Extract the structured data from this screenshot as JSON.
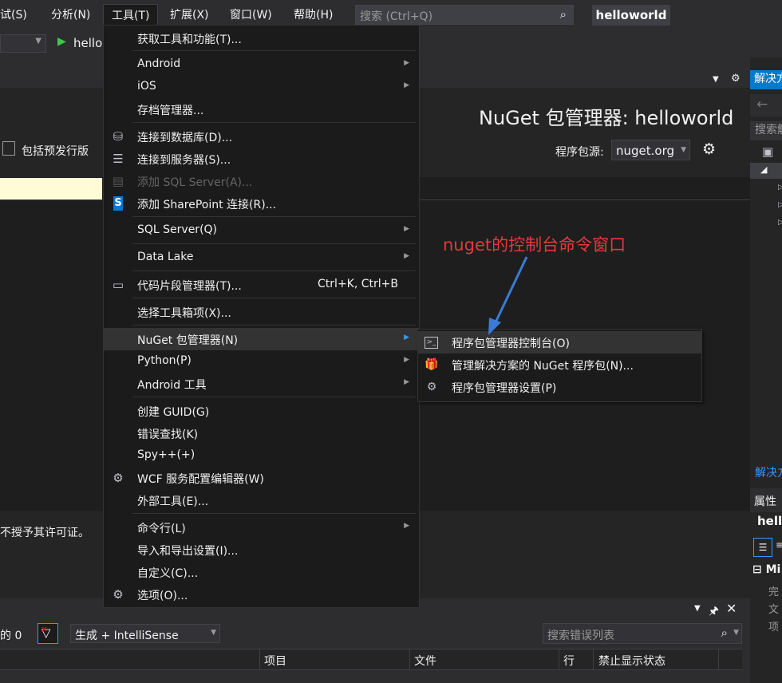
{
  "menubar": {
    "items": [
      "试(S)",
      "分析(N)",
      "工具(T)",
      "扩展(X)",
      "窗口(W)",
      "帮助(H)"
    ],
    "search_placeholder": "搜索 (Ctrl+Q)",
    "solution_title": "helloworld"
  },
  "toolbar": {
    "run_label": "hello"
  },
  "nuget_page": {
    "title": "NuGet 包管理器: helloworld",
    "include_prerelease": "包括预发行版",
    "source_label": "程序包源:",
    "source_value": "nuget.org",
    "license_text": "不授予其许可证。"
  },
  "tools_menu": {
    "items": [
      {
        "label": "获取工具和功能(T)..."
      },
      {
        "label": "Android"
      },
      {
        "label": "iOS"
      },
      {
        "label": "存档管理器..."
      },
      {
        "label": "连接到数据库(D)..."
      },
      {
        "label": "连接到服务器(S)..."
      },
      {
        "label": "添加 SQL Server(A)..."
      },
      {
        "label": "添加 SharePoint 连接(R)..."
      },
      {
        "label": "SQL Server(Q)"
      },
      {
        "label": "Data Lake"
      },
      {
        "label": "代码片段管理器(T)...",
        "shortcut": "Ctrl+K, Ctrl+B"
      },
      {
        "label": "选择工具箱项(X)..."
      },
      {
        "label": "NuGet 包管理器(N)"
      },
      {
        "label": "Python(P)"
      },
      {
        "label": "Android 工具"
      },
      {
        "label": "创建 GUID(G)"
      },
      {
        "label": "错误查找(K)"
      },
      {
        "label": "Spy++(+)"
      },
      {
        "label": "WCF 服务配置编辑器(W)"
      },
      {
        "label": "外部工具(E)..."
      },
      {
        "label": "命令行(L)"
      },
      {
        "label": "导入和导出设置(I)..."
      },
      {
        "label": "自定义(C)..."
      },
      {
        "label": "选项(O)..."
      }
    ]
  },
  "nuget_submenu": {
    "items": [
      {
        "label": "程序包管理器控制台(O)"
      },
      {
        "label": "管理解决方案的 NuGet 程序包(N)..."
      },
      {
        "label": "程序包管理器设置(P)"
      }
    ]
  },
  "annotation": {
    "text": "nuget的控制台命令窗口",
    "color": "#e8383d"
  },
  "error_list": {
    "message_count": "的 0",
    "build_filter": "生成 + IntelliSense",
    "search_placeholder": "搜索错误列表",
    "columns": [
      "项目",
      "文件",
      "行",
      "禁止显示状态"
    ]
  },
  "solution_explorer": {
    "title": "解决方",
    "search": "搜索解",
    "bottom_tab": "解决方"
  },
  "properties": {
    "title": "属性",
    "object": "hello",
    "group": "Mi",
    "rows": [
      "完",
      "文",
      "项"
    ]
  }
}
